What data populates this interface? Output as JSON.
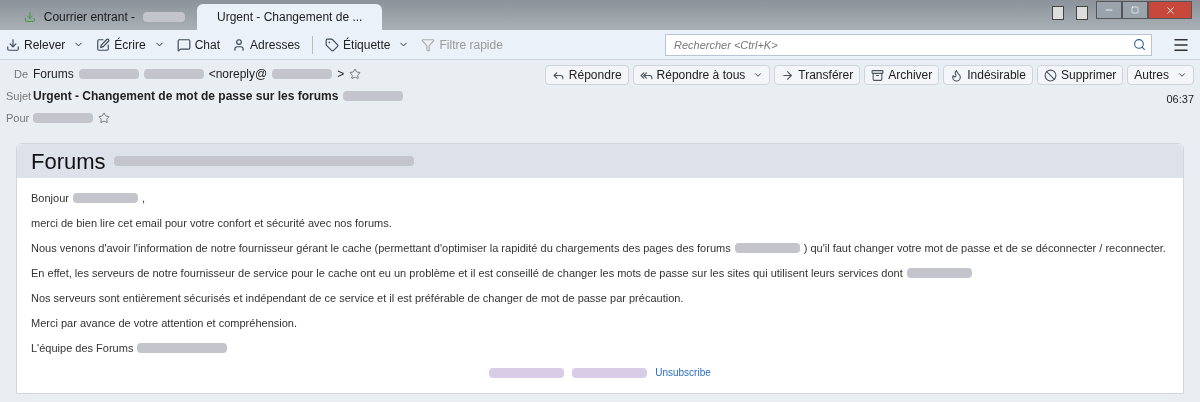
{
  "tabs": [
    {
      "kind": "inbox",
      "selected": false,
      "parts": [
        {
          "kind": "text",
          "text": "Courrier entrant -"
        },
        {
          "kind": "redacted"
        }
      ]
    },
    {
      "kind": "message",
      "selected": true,
      "parts": [
        {
          "kind": "text",
          "text": "Urgent - Changement de ..."
        }
      ]
    }
  ],
  "toolbar": [
    {
      "kind": "get",
      "label": "Relever",
      "menu": true
    },
    {
      "kind": "write",
      "label": "Écrire",
      "menu": true
    },
    {
      "kind": "chat",
      "label": "Chat",
      "menu": false
    },
    {
      "kind": "contacts",
      "label": "Adresses",
      "menu": false
    },
    {
      "kind": "tag",
      "label": "Étiquette",
      "menu": true
    },
    {
      "kind": "filter",
      "label": "Filtre rapide",
      "menu": false,
      "disabled": true
    }
  ],
  "search": {
    "placeholder": "Rechercher <Ctrl+K>"
  },
  "header": {
    "fields": [
      {
        "label": "De",
        "bold": false,
        "star": true,
        "parts": [
          {
            "kind": "text",
            "text": "Forums"
          },
          {
            "kind": "redacted"
          },
          {
            "kind": "redacted"
          },
          {
            "kind": "text",
            "text": "<noreply@"
          },
          {
            "kind": "redacted"
          },
          {
            "kind": "text",
            "text": ">"
          }
        ]
      },
      {
        "label": "Sujet",
        "bold": true,
        "star": false,
        "parts": [
          {
            "kind": "text",
            "text": "Urgent - Changement de mot de passe sur les forums"
          },
          {
            "kind": "redacted"
          }
        ]
      },
      {
        "label": "Pour",
        "bold": false,
        "star": true,
        "parts": [
          {
            "kind": "redacted"
          }
        ]
      }
    ],
    "actions": [
      {
        "kind": "reply",
        "label": "Répondre",
        "menu": false
      },
      {
        "kind": "reply-all",
        "label": "Répondre à tous",
        "menu": true
      },
      {
        "kind": "forward",
        "label": "Transférer",
        "menu": false
      },
      {
        "kind": "archive",
        "label": "Archiver",
        "menu": false
      },
      {
        "kind": "junk",
        "label": "Indésirable",
        "menu": false
      },
      {
        "kind": "delete",
        "label": "Supprimer",
        "menu": false
      },
      {
        "kind": "more",
        "label": "Autres",
        "menu": true
      }
    ],
    "time": "06:37"
  },
  "message": {
    "title_parts": [
      {
        "kind": "text",
        "text": "Forums"
      },
      {
        "kind": "redacted"
      }
    ],
    "paragraphs": [
      [
        {
          "kind": "text",
          "text": "Bonjour"
        },
        {
          "kind": "redacted"
        },
        {
          "kind": "text",
          "text": ","
        }
      ],
      [
        {
          "kind": "text",
          "text": "merci de bien lire cet email pour votre confort et sécurité avec nos forums."
        }
      ],
      [
        {
          "kind": "text",
          "text": "Nous venons d'avoir l'information de notre fournisseur gérant le cache (permettant d'optimiser la rapidité du chargements des pages des forums"
        },
        {
          "kind": "redacted"
        },
        {
          "kind": "text",
          "text": ") qu'il faut changer votre mot de passe et de se déconnecter / reconnecter."
        }
      ],
      [
        {
          "kind": "text",
          "text": "En effet, les serveurs de notre fournisseur de service pour le cache ont eu un problème et il est conseillé de changer les mots de passe sur les sites qui utilisent leurs services dont"
        },
        {
          "kind": "redacted"
        }
      ],
      [
        {
          "kind": "text",
          "text": "Nos serveurs sont entièrement sécurisés et indépendant de ce service et il est préférable de changer de mot de passe par précaution."
        }
      ],
      [
        {
          "kind": "text",
          "text": "Merci par avance de votre attention et compréhension."
        }
      ],
      [
        {
          "kind": "text",
          "text": "L'équipe des Forums"
        },
        {
          "kind": "redacted"
        }
      ]
    ],
    "footer_parts": [
      {
        "kind": "redacted"
      },
      {
        "kind": "redacted"
      },
      {
        "kind": "link",
        "text": "Unsubscribe"
      }
    ]
  }
}
